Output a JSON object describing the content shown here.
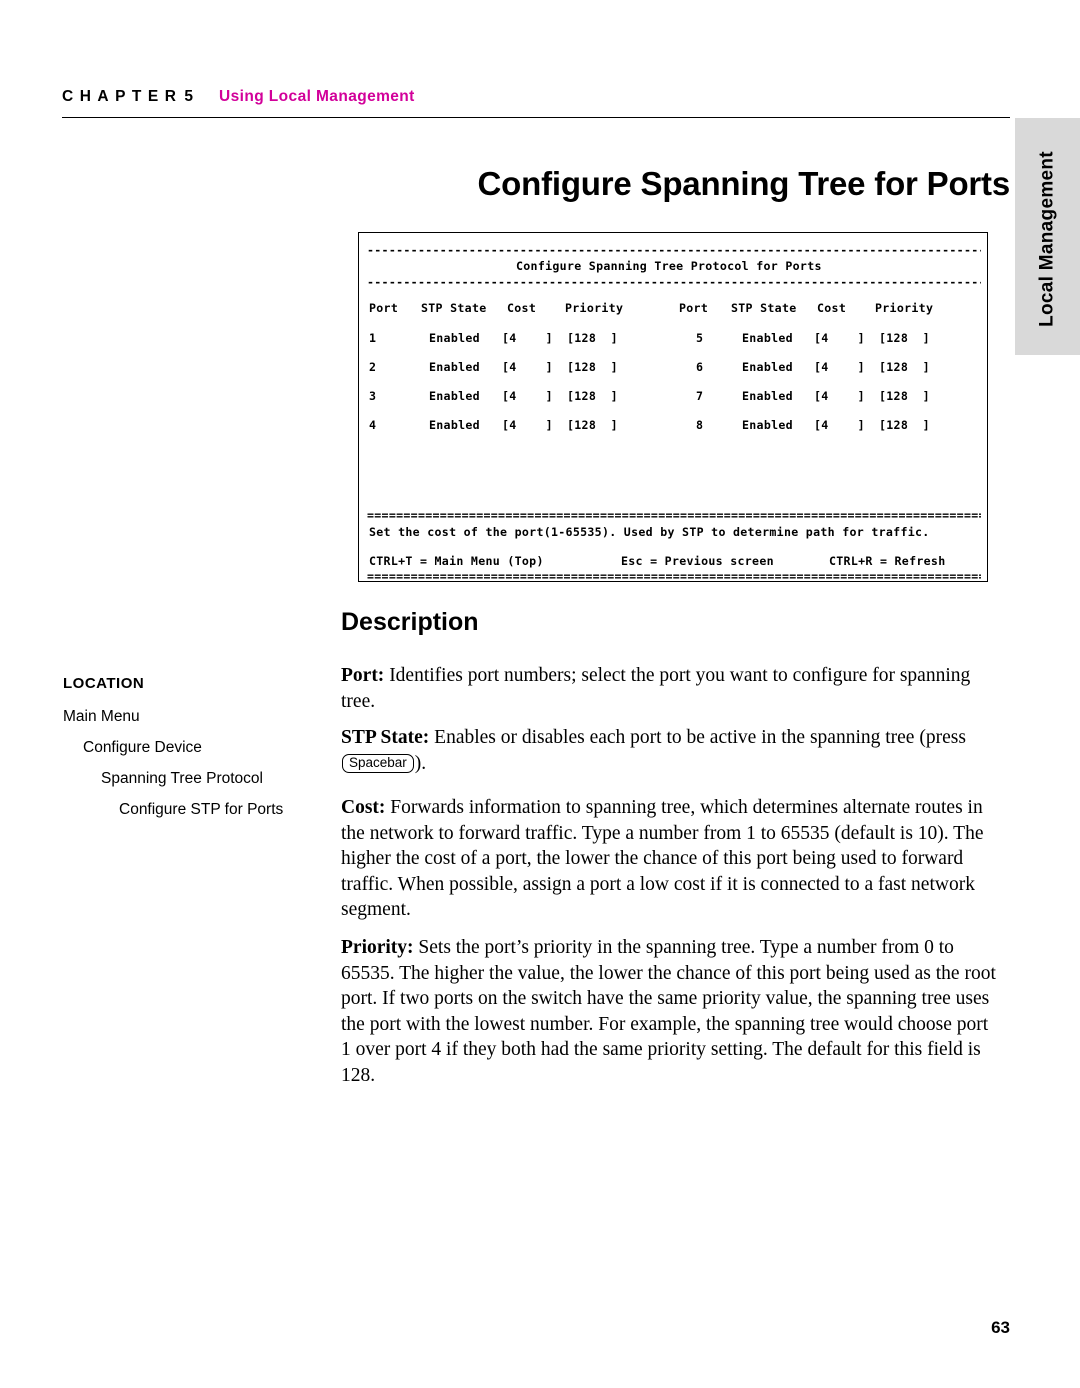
{
  "header": {
    "chapter_word": "CHAPTER",
    "chapter_number": "5",
    "chapter_title": "Using Local Management",
    "accent_color": "#d2009a"
  },
  "side_tab": {
    "label": "Local Management",
    "background": "#d9d9d9"
  },
  "page_title": "Configure Spanning Tree for Ports",
  "terminal": {
    "screen_title": "Configure Spanning Tree Protocol for Ports",
    "rule_char": "-",
    "footer_rule_char": "=",
    "columns_left": [
      "Port",
      "STP State",
      "Cost",
      "Priority"
    ],
    "columns_right": [
      "Port",
      "STP State",
      "Cost",
      "Priority"
    ],
    "rows": [
      {
        "port_l": "1",
        "state_l": "Enabled",
        "cost_l": "[4    ]",
        "prio_l": "[128  ]",
        "port_r": "5",
        "state_r": "Enabled",
        "cost_r": "[4    ]",
        "prio_r": "[128  ]"
      },
      {
        "port_l": "2",
        "state_l": "Enabled",
        "cost_l": "[4    ]",
        "prio_l": "[128  ]",
        "port_r": "6",
        "state_r": "Enabled",
        "cost_r": "[4    ]",
        "prio_r": "[128  ]"
      },
      {
        "port_l": "3",
        "state_l": "Enabled",
        "cost_l": "[4    ]",
        "prio_l": "[128  ]",
        "port_r": "7",
        "state_r": "Enabled",
        "cost_r": "[4    ]",
        "prio_r": "[128  ]"
      },
      {
        "port_l": "4",
        "state_l": "Enabled",
        "cost_l": "[4    ]",
        "prio_l": "[128  ]",
        "port_r": "8",
        "state_r": "Enabled",
        "cost_r": "[4    ]",
        "prio_r": "[128  ]"
      }
    ],
    "help_line": "Set the cost of the port(1-65535). Used by STP to determine path for traffic.",
    "keys": {
      "top": "CTRL+T = Main Menu (Top)",
      "previous": "Esc = Previous screen",
      "refresh": "CTRL+R = Refresh"
    }
  },
  "description": {
    "heading": "Description",
    "paragraphs": {
      "port_label": "Port:",
      "port_text": " Identifies port numbers; select the port you want to configure for spanning tree.",
      "stp_label": "STP State:",
      "stp_text_a": " Enables or disables each port to be active in the spanning tree (press ",
      "stp_key": "Spacebar",
      "stp_text_b": ").",
      "cost_label": "Cost:",
      "cost_text": " Forwards information to spanning tree, which determines alternate routes in the network to forward traffic. Type a number from 1 to 65535 (default is 10). The higher the cost of a port, the lower the chance of this port being used to forward traffic. When possible, assign a port a low cost if it is connected to a fast network segment.",
      "priority_label": "Priority:",
      "priority_text": " Sets the port’s priority in the spanning tree. Type a number from 0 to 65535. The higher the value, the lower the chance of this port being used as the root port. If two ports on the switch have the same priority value, the spanning tree uses the port with the lowest number. For example, the spanning tree would choose port 1 over port 4 if they both had the same priority setting. The default for this field is 128."
    }
  },
  "location": {
    "title": "LOCATION",
    "items": [
      "Main Menu",
      "Configure Device",
      "Spanning Tree Protocol",
      "Configure STP for Ports"
    ]
  },
  "page_number": "63"
}
